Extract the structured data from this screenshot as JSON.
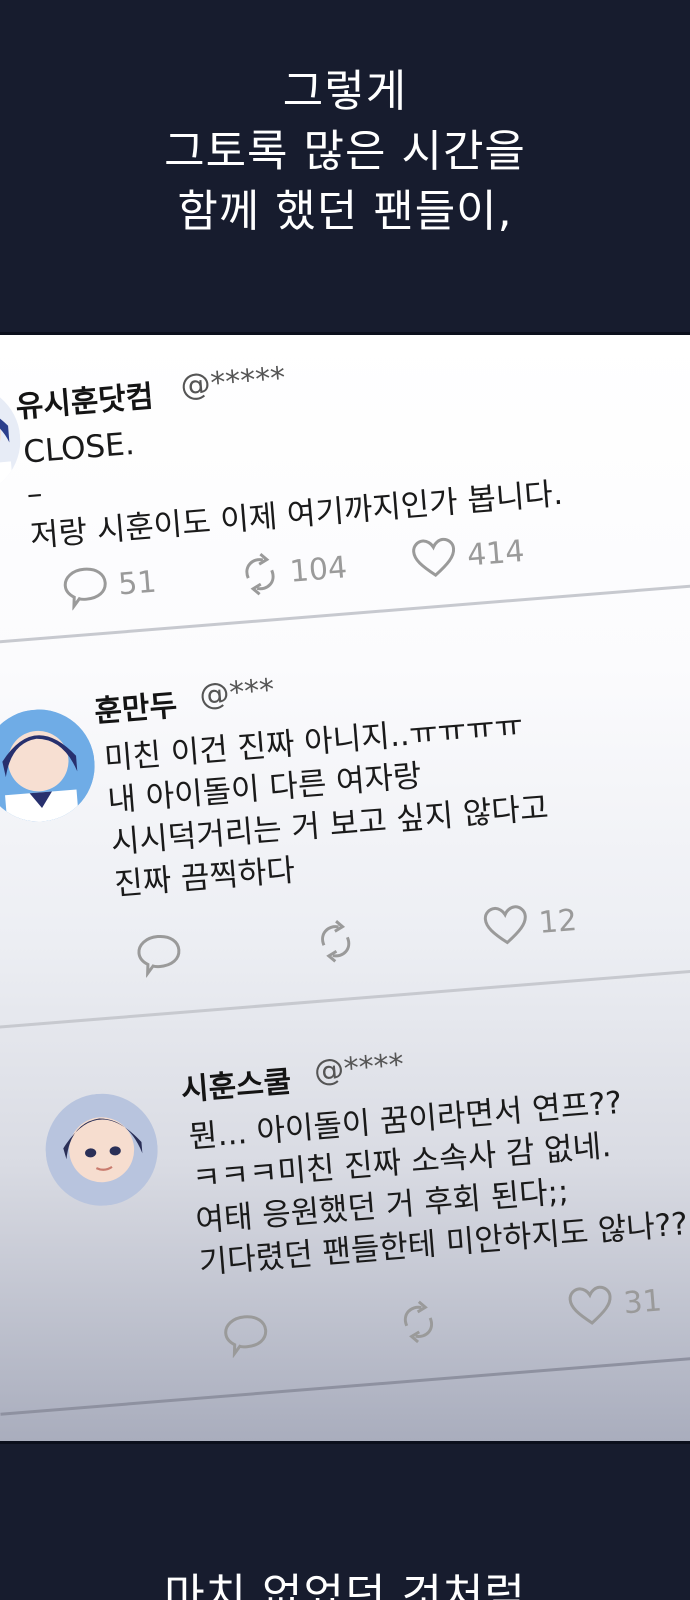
{
  "captions": {
    "top_lines": [
      "그렇게",
      "그토록 많은 시간을",
      "함께 했던 팬들이,"
    ],
    "bottom_line": "마치 없었던 것처럼"
  },
  "posts": [
    {
      "username": "유시훈닷컴",
      "handle": "@*****",
      "lines": [
        "CLOSE.",
        "–",
        "저랑 시훈이도 이제 여기까지인가 봅니다."
      ],
      "comments": "51",
      "retweets": "104",
      "likes": "414"
    },
    {
      "username": "훈만두",
      "handle": "@***",
      "lines": [
        "미친 이건 진짜 아니지..ㅠㅠㅠㅠ",
        "내 아이돌이 다른 여자랑",
        "시시덕거리는 거 보고 싶지 않다고",
        "진짜 끔찍하다"
      ],
      "comments": "",
      "retweets": "",
      "likes": "12"
    },
    {
      "username": "시훈스쿨",
      "handle": "@****",
      "lines": [
        "뭔... 아이돌이 꿈이라면서 연프??",
        "ㅋㅋㅋ미친 진짜 소속사 감 없네.",
        "여태 응원했던 거 후회 된다;;",
        "기다렸던 팬들한테 미안하지도 않나??"
      ],
      "comments": "",
      "retweets": "",
      "likes": "31"
    }
  ],
  "icons": {
    "comment": "speech-bubble-icon",
    "retweet": "retweet-icon",
    "like": "heart-icon"
  },
  "colors": {
    "panel_dark": "#171c2e",
    "icon_gray": "#9a9a9a"
  }
}
